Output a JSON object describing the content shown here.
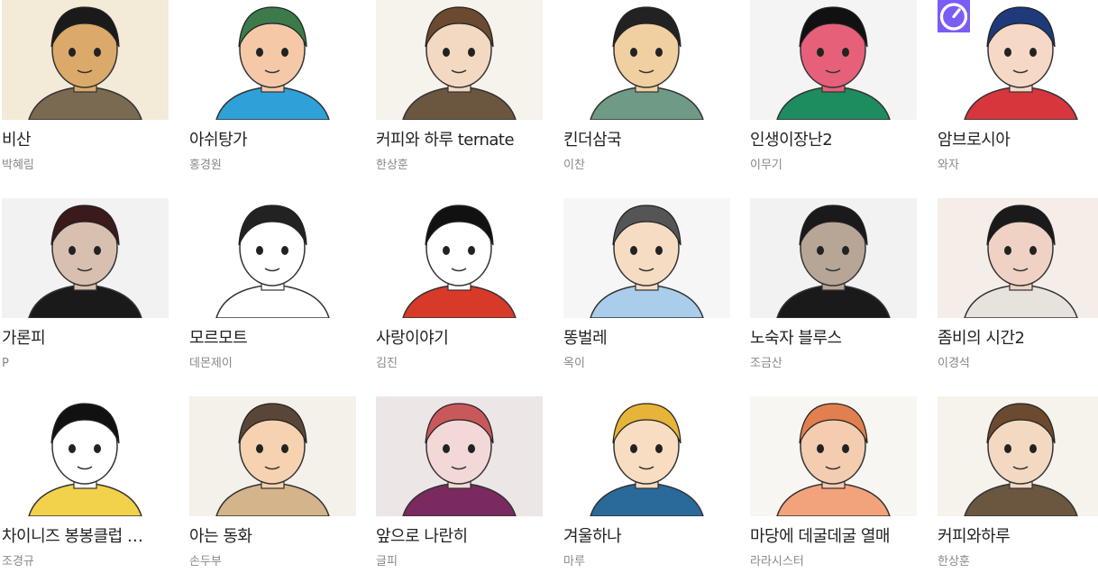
{
  "cards": [
    {
      "title": "비산",
      "author": "박혜림",
      "bg": "#f3ead7",
      "skin": "#dba96a",
      "hair": "#1a1a1a",
      "cloth": "#7a6a52"
    },
    {
      "title": "아쉬탕가",
      "author": "홍경원",
      "bg": "#ffffff",
      "skin": "#f5c9a8",
      "hair": "#3c7a4a",
      "cloth": "#2fa0d8"
    },
    {
      "title": "커피와 하루 ternate",
      "author": "한상훈",
      "bg": "#f6f2ec",
      "skin": "#f3d9c2",
      "hair": "#6b4a30",
      "cloth": "#6b5640"
    },
    {
      "title": "킨더삼국",
      "author": "이찬",
      "bg": "#ffffff",
      "skin": "#f0cfa0",
      "hair": "#222222",
      "cloth": "#6f9a86"
    },
    {
      "title": "인생이장난2",
      "author": "이무기",
      "bg": "#f4f4f4",
      "skin": "#e6607a",
      "hair": "#111111",
      "cloth": "#1d8c5e"
    },
    {
      "title": "암브로시아",
      "author": "와자",
      "bg": "#ffffff",
      "skin": "#f6d8c6",
      "hair": "#1f3a7a",
      "cloth": "#d6363c",
      "badge": true
    },
    {
      "title": "가론피",
      "author": "P",
      "bg": "#f2f2f2",
      "skin": "#d8c0b0",
      "hair": "#3a1a1a",
      "cloth": "#1a1a1a"
    },
    {
      "title": "모르모트",
      "author": "데몬제이",
      "bg": "#ffffff",
      "skin": "#ffffff",
      "hair": "#222222",
      "cloth": "#ffffff"
    },
    {
      "title": "사랑이야기",
      "author": "김진",
      "bg": "#ffffff",
      "skin": "#ffffff",
      "hair": "#111111",
      "cloth": "#d83a2a"
    },
    {
      "title": "똥벌레",
      "author": "옥이",
      "bg": "#f6f6f6",
      "skin": "#f7dcc4",
      "hair": "#555555",
      "cloth": "#a9cdea"
    },
    {
      "title": "노숙자 블루스",
      "author": "조금산",
      "bg": "#f2f2f2",
      "skin": "#b7a596",
      "hair": "#1a1a1a",
      "cloth": "#1a1a1a"
    },
    {
      "title": "좀비의 시간2",
      "author": "이경석",
      "bg": "#f4ede8",
      "skin": "#efd2c3",
      "hair": "#1a1a1a",
      "cloth": "#e8e2dc"
    },
    {
      "title": "차이니즈 봉봉클럽 …",
      "author": "조경규",
      "bg": "#ffffff",
      "skin": "#ffffff",
      "hair": "#111111",
      "cloth": "#f2d24a"
    },
    {
      "title": "아는 동화",
      "author": "손두부",
      "bg": "#f4f0ea",
      "skin": "#f6d2b0",
      "hair": "#5a4638",
      "cloth": "#d4b48a"
    },
    {
      "title": "앞으로 나란히",
      "author": "글피",
      "bg": "#ede6e6",
      "skin": "#f2d8d6",
      "hair": "#c8585a",
      "cloth": "#7a2a5e"
    },
    {
      "title": "겨울하나",
      "author": "마루",
      "bg": "#ffffff",
      "skin": "#f8ddc2",
      "hair": "#e6b438",
      "cloth": "#2a6a9a"
    },
    {
      "title": "마당에 데굴데굴 열매",
      "author": "라라시스터",
      "bg": "#f8f6f2",
      "skin": "#f4ccb0",
      "hair": "#e27f4e",
      "cloth": "#f2a37c"
    },
    {
      "title": "커피와하루",
      "author": "한상훈",
      "bg": "#f6f2ec",
      "skin": "#f3d9c2",
      "hair": "#6b4a30",
      "cloth": "#6b5640"
    }
  ]
}
